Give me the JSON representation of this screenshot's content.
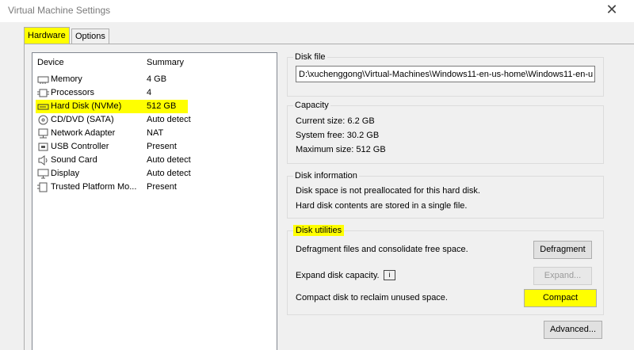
{
  "window": {
    "title": "Virtual Machine Settings"
  },
  "tabs": [
    {
      "label": "Hardware"
    },
    {
      "label": "Options"
    }
  ],
  "devices": {
    "header_device": "Device",
    "header_summary": "Summary",
    "items": [
      {
        "name": "Memory",
        "summary": "4 GB",
        "icon": "memory-icon"
      },
      {
        "name": "Processors",
        "summary": "4",
        "icon": "processor-icon"
      },
      {
        "name": "Hard Disk (NVMe)",
        "summary": "512 GB",
        "icon": "hard-disk-icon",
        "selected": true
      },
      {
        "name": "CD/DVD (SATA)",
        "summary": "Auto detect",
        "icon": "cd-dvd-icon"
      },
      {
        "name": "Network Adapter",
        "summary": "NAT",
        "icon": "network-adapter-icon"
      },
      {
        "name": "USB Controller",
        "summary": "Present",
        "icon": "usb-controller-icon"
      },
      {
        "name": "Sound Card",
        "summary": "Auto detect",
        "icon": "sound-card-icon"
      },
      {
        "name": "Display",
        "summary": "Auto detect",
        "icon": "display-icon"
      },
      {
        "name": "Trusted Platform Mo...",
        "summary": "Present",
        "icon": "tpm-icon"
      }
    ]
  },
  "disk_file": {
    "label": "Disk file",
    "value": "D:\\xuchenggong\\Virtual-Machines\\Windows11-en-us-home\\Windows11-en-u"
  },
  "capacity": {
    "label": "Capacity",
    "current": "Current size:  6.2 GB",
    "free": "System free:  30.2 GB",
    "max": "Maximum size:  512 GB"
  },
  "disk_info": {
    "label": "Disk information",
    "line1": "Disk space is not preallocated for this hard disk.",
    "line2": "Hard disk contents are stored in a single file."
  },
  "utilities": {
    "label": "Disk utilities",
    "defrag_text": "Defragment files and consolidate free space.",
    "defrag_button": "Defragment",
    "expand_text": "Expand disk capacity.",
    "expand_button": "Expand...",
    "compact_text": "Compact disk to reclaim unused space.",
    "compact_button": "Compact"
  },
  "advanced_button": "Advanced...",
  "colors": {
    "highlight": "#ffff00",
    "window_bg": "#f0f0f0"
  }
}
